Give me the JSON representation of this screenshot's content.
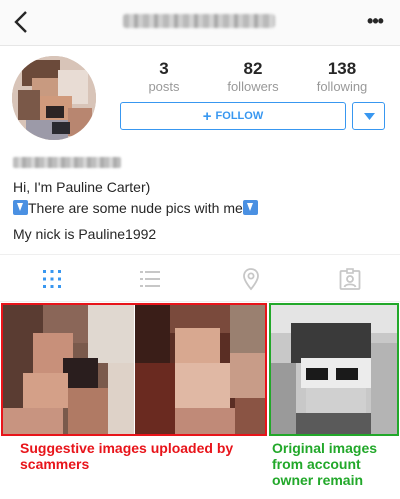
{
  "header": {
    "back_icon": "chevron-left-icon",
    "more_icon": "more-horizontal-icon",
    "more_glyph": "•••"
  },
  "profile": {
    "stats": [
      {
        "value": "3",
        "label": "posts"
      },
      {
        "value": "82",
        "label": "followers"
      },
      {
        "value": "138",
        "label": "following"
      }
    ],
    "follow_label": "FOLLOW",
    "follow_plus": "+",
    "bio": {
      "line1": "Hi, I'm Pauline Carter)",
      "line2": "There are some nude pics with me",
      "line3": "My nick is Pauline1992"
    }
  },
  "tabs": [
    {
      "name": "grid-icon",
      "active": true
    },
    {
      "name": "list-icon",
      "active": false
    },
    {
      "name": "location-pin-icon",
      "active": false
    },
    {
      "name": "tagged-person-icon",
      "active": false
    }
  ],
  "annotations": {
    "red_caption": "Suggestive images uploaded by scammers",
    "green_caption": "Original images from account owner remain",
    "red_color": "#e8141a",
    "green_color": "#22a82a"
  },
  "colors": {
    "accent_blue": "#3897f0",
    "muted_gray": "#999999",
    "text": "#262626"
  }
}
